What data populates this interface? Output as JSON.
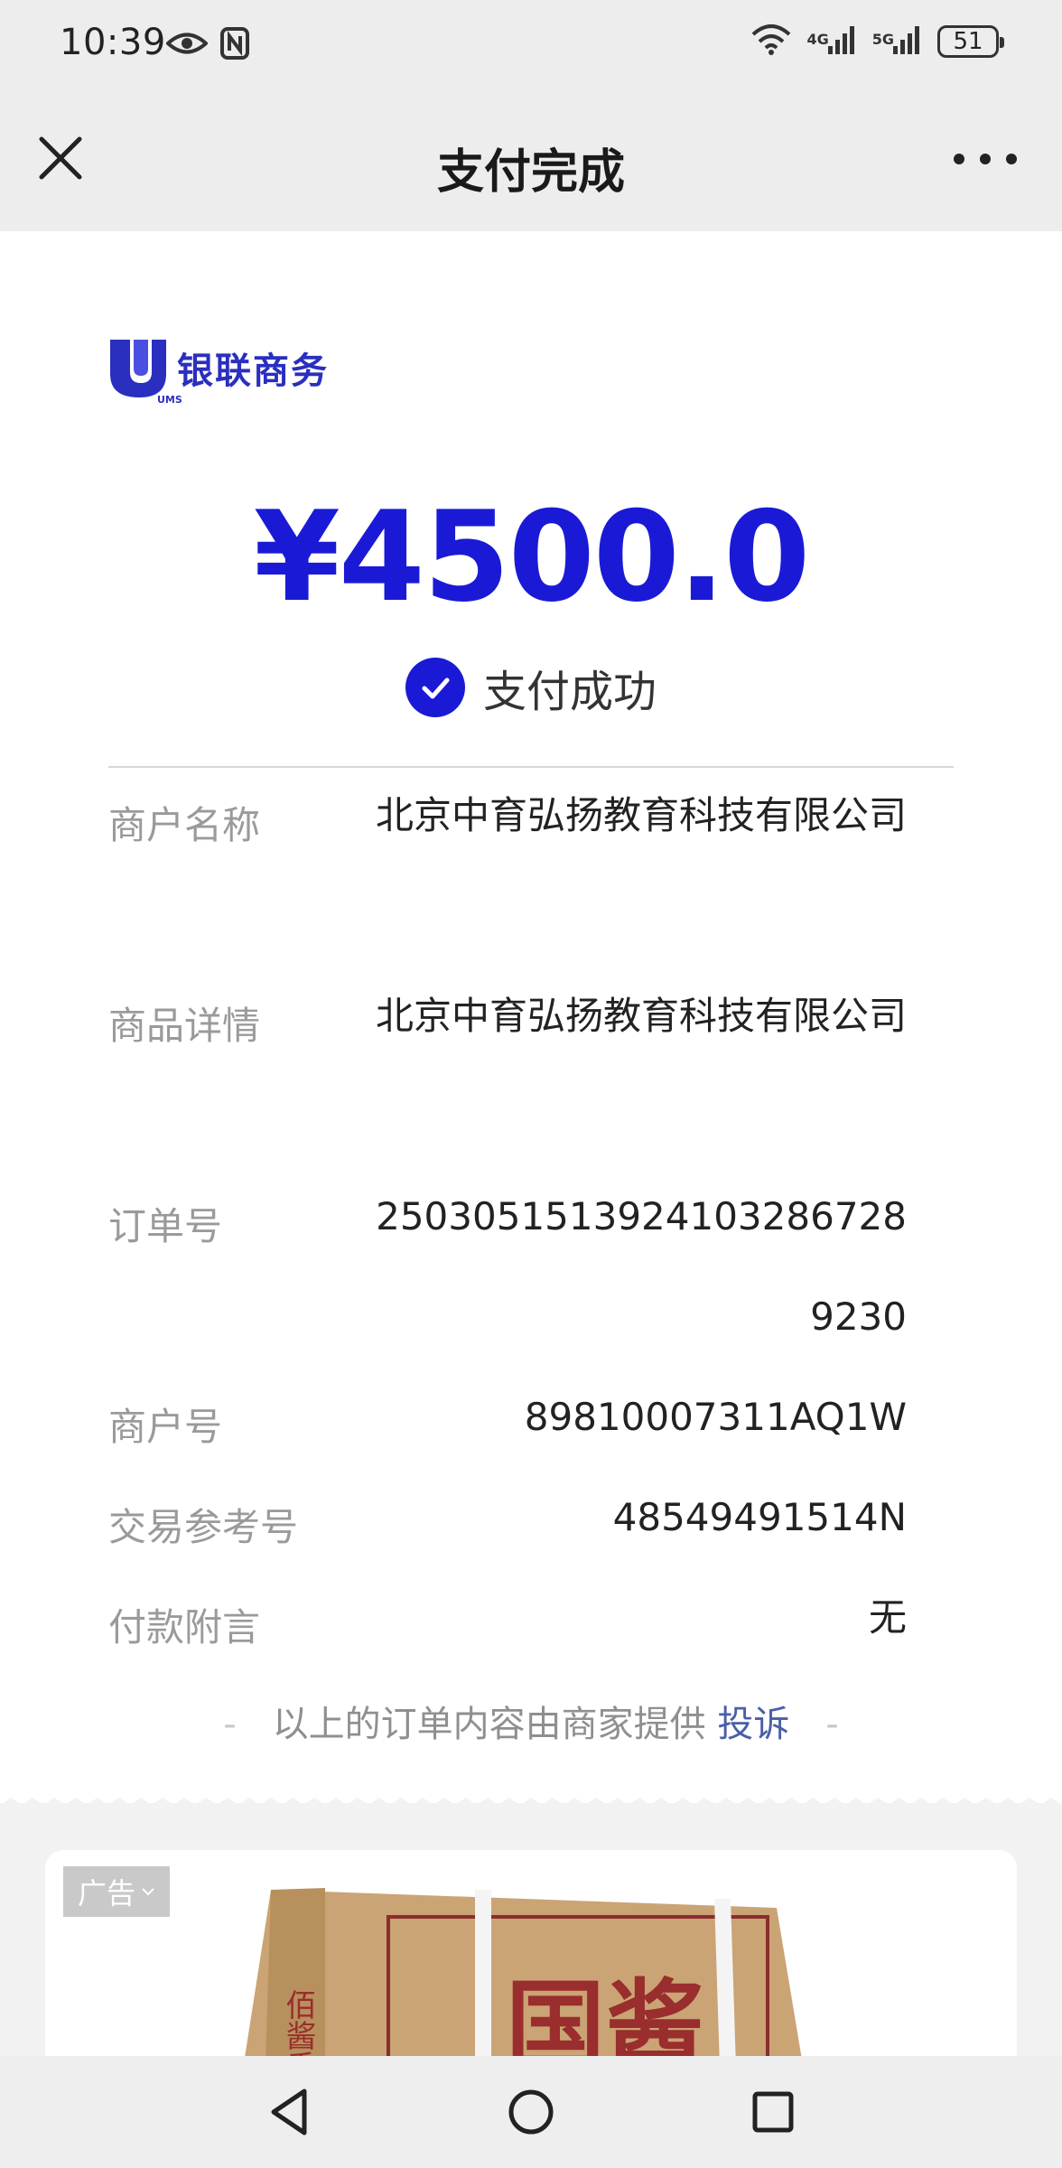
{
  "status_bar": {
    "time": "10:39",
    "net1": "4G",
    "net2": "5G",
    "battery": "51",
    "icons": [
      "eye-icon",
      "nfc-icon",
      "wifi-icon",
      "signal-icon",
      "signal-icon",
      "battery-icon"
    ]
  },
  "header": {
    "title": "支付完成"
  },
  "merchant_logo": {
    "text": "银联商务",
    "sub": "UMS"
  },
  "payment": {
    "amount": "¥4500.0",
    "status": "支付成功",
    "accent_color": "#1a1ad6"
  },
  "details": [
    {
      "label": "商户名称",
      "value": "北京中育弘扬教育科技有限公司"
    },
    {
      "label": "商品详情",
      "value": "北京中育弘扬教育科技有限公司"
    },
    {
      "label": "订单号",
      "value": "25030515139241032867289230"
    },
    {
      "label": "商户号",
      "value": "89810007311AQ1W"
    },
    {
      "label": "交易参考号",
      "value": "48549491514N"
    },
    {
      "label": "付款附言",
      "value": "无"
    }
  ],
  "footer": {
    "dash": "-",
    "note": "以上的订单内容由商家提供",
    "complain": "投诉"
  },
  "ad": {
    "tag": "广告",
    "box_text": "国酱",
    "box_side_text": "佰酱香"
  }
}
